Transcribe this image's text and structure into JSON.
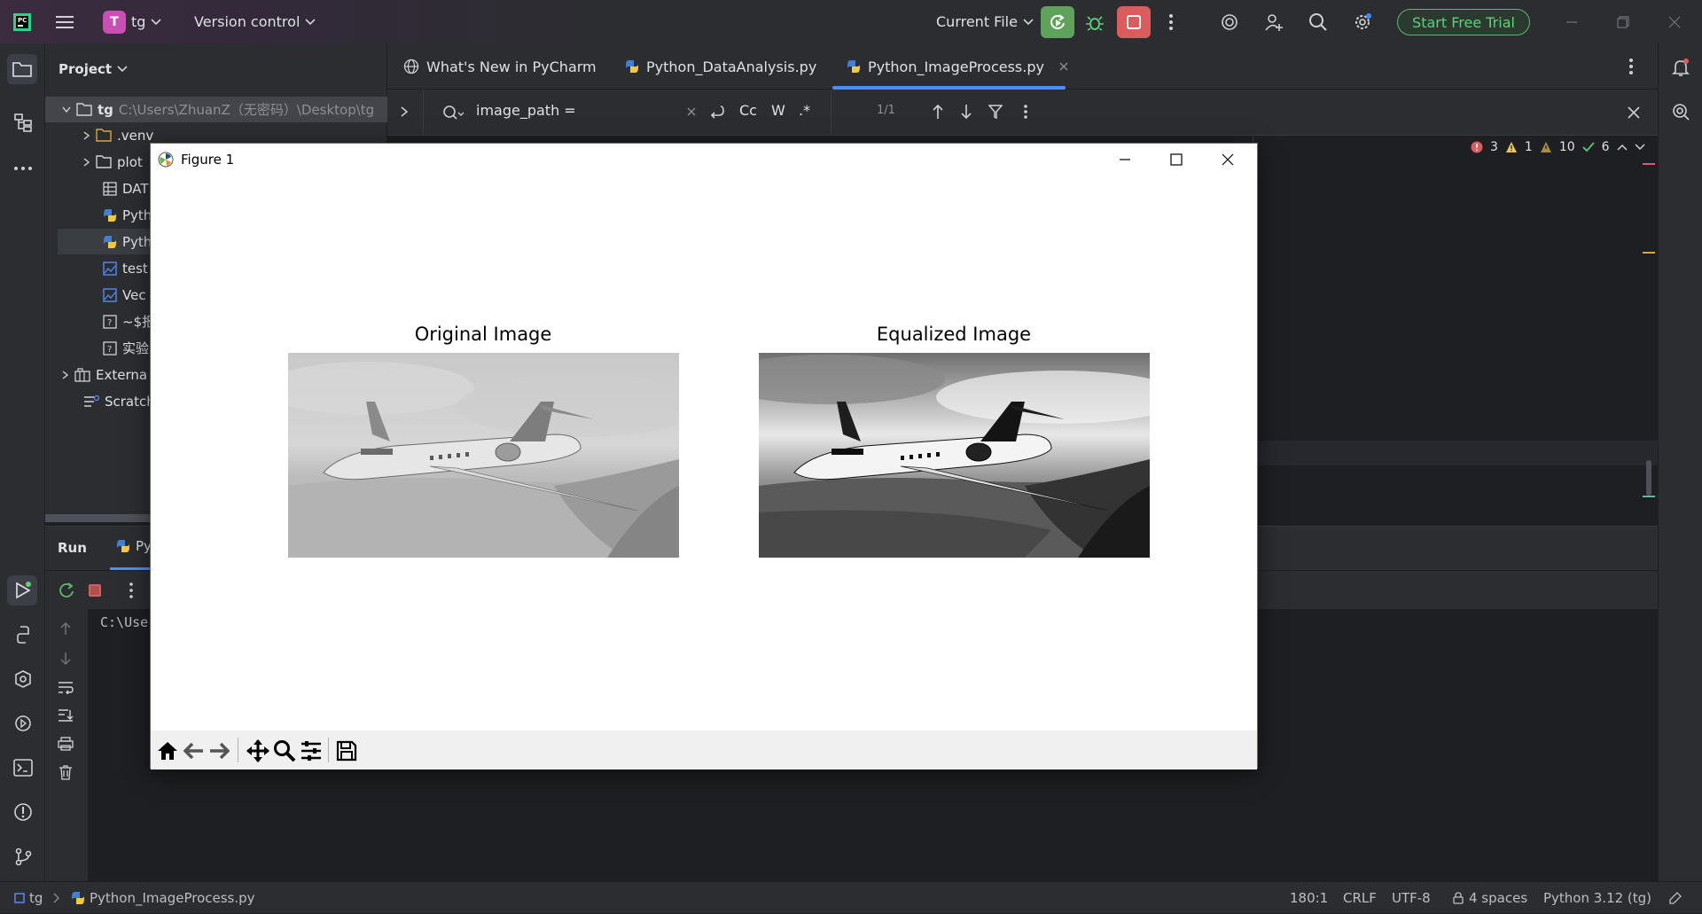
{
  "titlebar": {
    "project_badge": "T",
    "project_name": "tg",
    "vcs_label": "Version control",
    "run_config": "Current File",
    "trial_label": "Start Free Trial"
  },
  "project_panel": {
    "title": "Project",
    "root_name": "tg",
    "root_path": "C:\\Users\\ZhuanZ（无密码）\\Desktop\\tg",
    "items": [
      {
        "label": ".venv",
        "type": "folder"
      },
      {
        "label": "plot",
        "type": "folder"
      },
      {
        "label": "DAT",
        "type": "table"
      },
      {
        "label": "Pyth",
        "type": "python"
      },
      {
        "label": "Pyth",
        "type": "python"
      },
      {
        "label": "test",
        "type": "image"
      },
      {
        "label": "Vec",
        "type": "image"
      },
      {
        "label": "~$报",
        "type": "unknown"
      },
      {
        "label": "实验",
        "type": "unknown"
      },
      {
        "label": "Externa",
        "type": "library"
      },
      {
        "label": "Scratch",
        "type": "scratch"
      }
    ]
  },
  "tabs": [
    {
      "label": "What's New in PyCharm",
      "active": false
    },
    {
      "label": "Python_DataAnalysis.py",
      "active": false
    },
    {
      "label": "Python_ImageProcess.py",
      "active": true
    }
  ],
  "search": {
    "query": "image_path =",
    "match_count": "1/1",
    "opt_case": "Cc",
    "opt_word": "W",
    "opt_regex": ".*"
  },
  "inspections": {
    "errors": "3",
    "warnings": "1",
    "weak_warnings": "10",
    "ok": "6"
  },
  "run_panel": {
    "title": "Run",
    "tab_label": "Py",
    "console_text": "C:\\Use"
  },
  "figure": {
    "window_title": "Figure 1",
    "left_title": "Original Image",
    "right_title": "Equalized Image"
  },
  "statusbar": {
    "project": "tg",
    "file": "Python_ImageProcess.py",
    "position": "180:1",
    "line_sep": "CRLF",
    "encoding": "UTF-8",
    "indent": "4 spaces",
    "interpreter": "Python 3.12 (tg)"
  },
  "colors": {
    "accent_green": "#5fa25b",
    "accent_red": "#db5c5c",
    "trial_green": "#5fd17a",
    "ide_bg": "#1e1f22",
    "panel_bg": "#2b2d30"
  }
}
